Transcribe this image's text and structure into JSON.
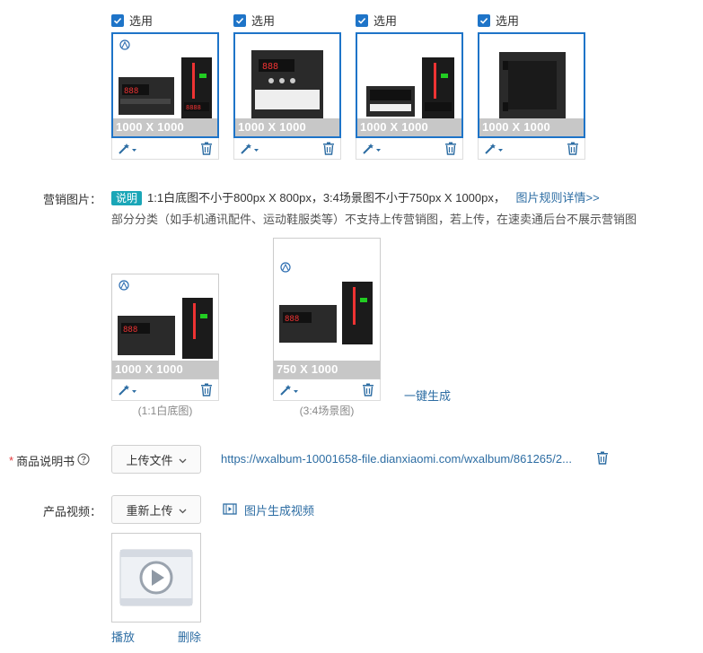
{
  "select_label": "选用",
  "main_images": [
    {
      "size_label": "1000 X 1000"
    },
    {
      "size_label": "1000 X 1000"
    },
    {
      "size_label": "1000 X 1000"
    },
    {
      "size_label": "1000 X 1000"
    }
  ],
  "marketing": {
    "label": "营销图片：",
    "tag": "说明",
    "tip_line1": "1:1白底图不小于800px X 800px，3:4场景图不小于750px X 1000px，",
    "rules_link": "图片规则详情>>",
    "tip_line2": "部分分类（如手机通讯配件、运动鞋服类等）不支持上传营销图，若上传，在速卖通后台不展示营销图",
    "images": [
      {
        "size_label": "1000 X 1000",
        "caption": "(1:1白底图)"
      },
      {
        "size_label": "750 X 1000",
        "caption": "(3:4场景图)"
      }
    ],
    "generate_link": "一键生成"
  },
  "manual": {
    "required_mark": "*",
    "label": "商品说明书",
    "upload_button": "上传文件",
    "file_url": "https://wxalbum-10001658-file.dianxiaomi.com/wxalbum/861265/2..."
  },
  "video": {
    "label": "产品视频：",
    "reupload_button": "重新上传",
    "generate_link": "图片生成视频",
    "play_link": "播放",
    "delete_link": "删除"
  },
  "colors": {
    "accent": "#1e74c8",
    "link": "#2d6da3",
    "tag": "#1aa6b7",
    "required": "#e4393c"
  }
}
